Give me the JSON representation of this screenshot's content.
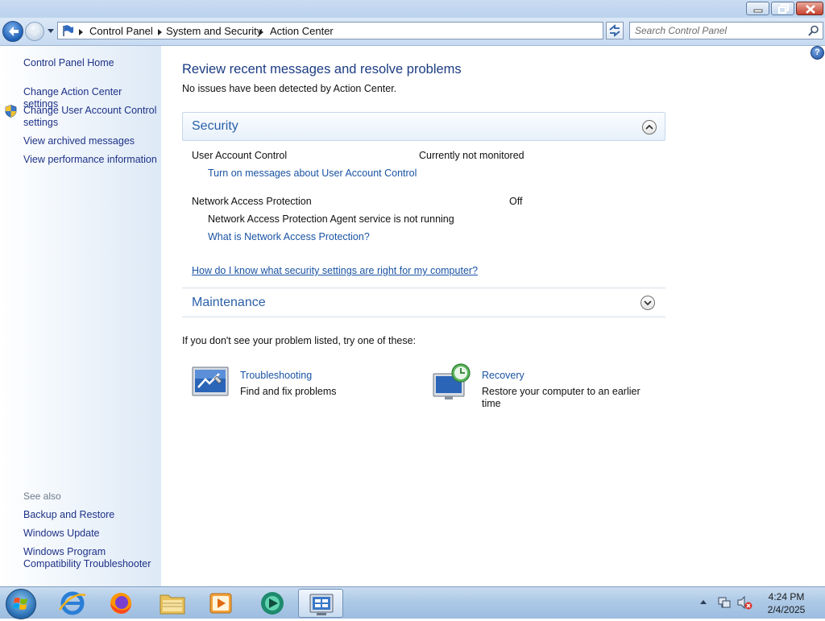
{
  "address_bar": {
    "breadcrumbs": [
      "Control Panel",
      "System and Security",
      "Action Center"
    ],
    "search_placeholder": "Search Control Panel"
  },
  "left_pane": {
    "home_link": "Control Panel Home",
    "tasks": [
      "Change Action Center settings",
      "Change User Account Control settings",
      "View archived messages",
      "View performance information"
    ],
    "see_also_heading": "See also",
    "see_also": [
      "Backup and Restore",
      "Windows Update",
      "Windows Program Compatibility Troubleshooter"
    ]
  },
  "main": {
    "title": "Review recent messages and resolve problems",
    "subtitle": "No issues have been detected by Action Center.",
    "security": {
      "heading": "Security",
      "items": [
        {
          "name": "User Account Control",
          "status": "Currently not monitored",
          "link": "Turn on messages about User Account Control"
        },
        {
          "name": "Network Access Protection",
          "status": "Off",
          "detail": "Network Access Protection Agent service is not running",
          "link": "What is Network Access Protection?"
        }
      ],
      "help_link": "How do I know what security settings are right for my computer?"
    },
    "maintenance": {
      "heading": "Maintenance"
    },
    "suggestions_intro": "If you don't see your problem listed, try one of these:",
    "tiles": [
      {
        "title": "Troubleshooting",
        "description": "Find and fix problems",
        "icon": "troubleshooting-icon"
      },
      {
        "title": "Recovery",
        "description": "Restore your computer to an earlier time",
        "icon": "recovery-icon"
      }
    ]
  },
  "taskbar": {
    "apps": [
      "internet-explorer",
      "firefox",
      "file-explorer",
      "media-player",
      "browser-app",
      "action-center-window"
    ],
    "time": "4:24 PM",
    "date": "2/4/2025"
  },
  "colors": {
    "link": "#1a53a3",
    "heading": "#1c3c82",
    "section_heading": "#2a60a8"
  }
}
